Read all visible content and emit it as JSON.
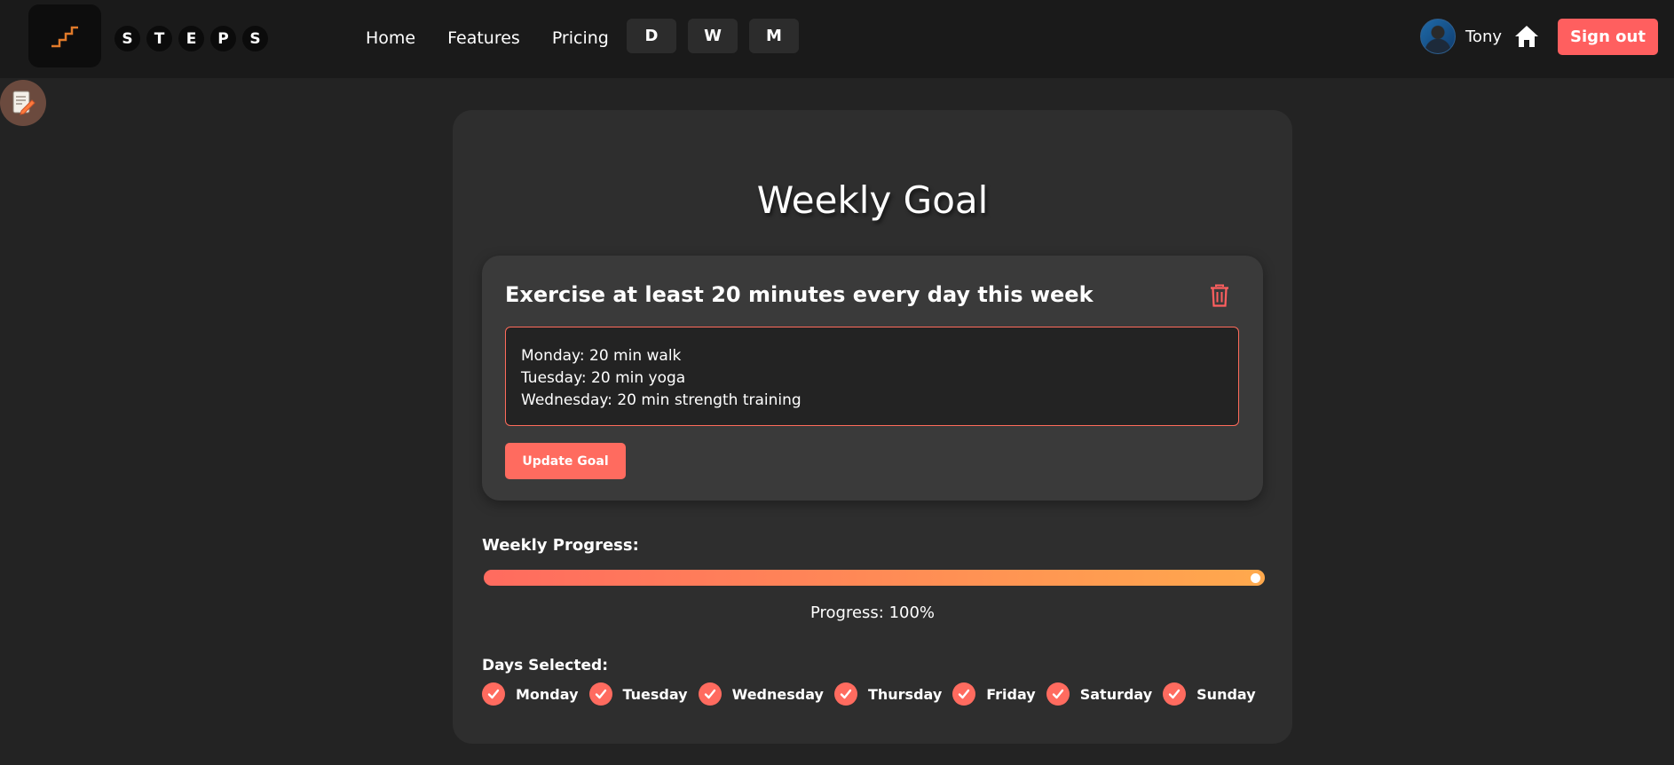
{
  "header": {
    "brand_letters": [
      "S",
      "T",
      "E",
      "P",
      "S"
    ],
    "nav": [
      {
        "label": "Home"
      },
      {
        "label": "Features"
      },
      {
        "label": "Pricing"
      }
    ],
    "periods": [
      {
        "label": "D"
      },
      {
        "label": "W"
      },
      {
        "label": "M"
      }
    ],
    "user_name": "Tony",
    "signout_label": "Sign out"
  },
  "main": {
    "title": "Weekly Goal",
    "goal": {
      "title": "Exercise at least 20 minutes every day this week",
      "details": "Monday: 20 min walk\nTuesday: 20 min yoga\nWednesday: 20 min strength training",
      "update_label": "Update Goal"
    },
    "progress": {
      "label": "Weekly Progress:",
      "value": 100,
      "text": "Progress: 100%"
    },
    "days": {
      "label": "Days Selected:",
      "items": [
        {
          "name": "Monday",
          "checked": true
        },
        {
          "name": "Tuesday",
          "checked": true
        },
        {
          "name": "Wednesday",
          "checked": true
        },
        {
          "name": "Thursday",
          "checked": true
        },
        {
          "name": "Friday",
          "checked": true
        },
        {
          "name": "Saturday",
          "checked": true
        },
        {
          "name": "Sunday",
          "checked": true
        }
      ]
    }
  },
  "colors": {
    "accent": "#ff6b5f",
    "signout": "#ff5f5f",
    "logo_stroke": "#e07a2a",
    "progress_end": "#ffa94d"
  },
  "icons": [
    "logo-stairs-icon",
    "home-icon",
    "trash-icon",
    "note-edit-icon",
    "checkmark-icon"
  ]
}
